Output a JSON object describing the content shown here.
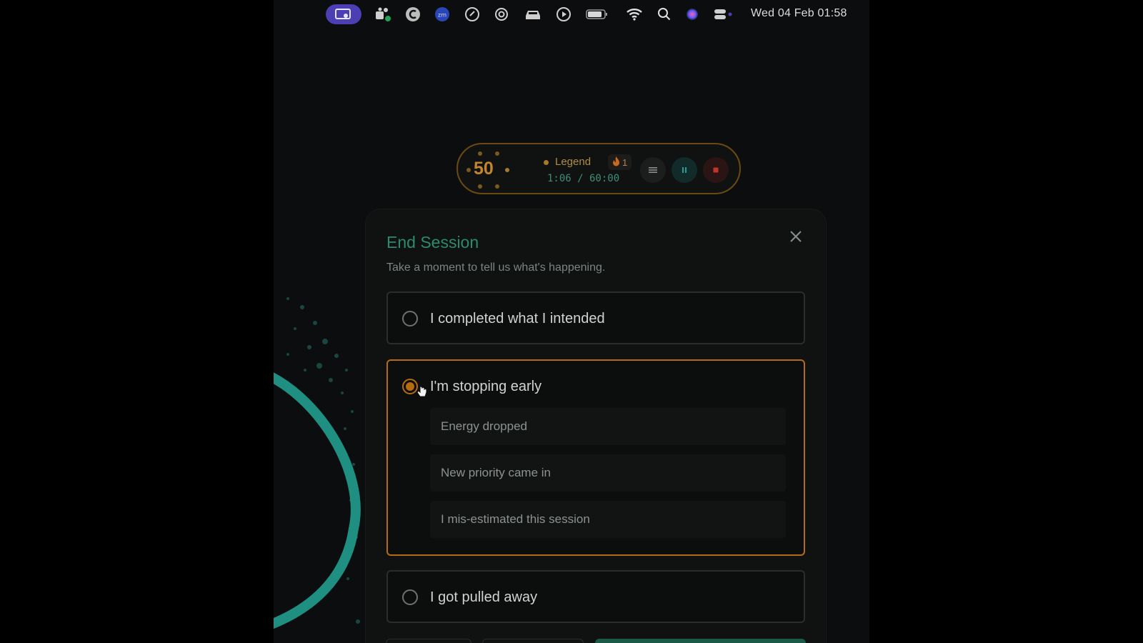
{
  "menubar": {
    "clock": "Wed 04 Feb  01:58",
    "icons": [
      "screen-share-icon",
      "teams-icon",
      "c-app-icon",
      "zoom-icon",
      "link-icon",
      "openai-icon",
      "car-icon",
      "play-icon",
      "battery-icon",
      "wifi-icon",
      "search-icon",
      "siri-icon",
      "control-center-icon"
    ],
    "zoom_label": "zm"
  },
  "timer": {
    "score": "50",
    "tier": "Legend",
    "streak": "1",
    "elapsed": "1:06 / 60:00",
    "menu_icon": "menu-icon",
    "pause_icon": "pause-icon",
    "stop_icon": "stop-icon"
  },
  "modal": {
    "title": "End Session",
    "subtitle": "Take a moment to tell us what's happening.",
    "options": [
      {
        "label": "I completed what I intended",
        "selected": false
      },
      {
        "label": "I'm stopping early",
        "selected": true,
        "reasons": [
          "Energy dropped",
          "New priority came in",
          "I mis-estimated this session"
        ]
      },
      {
        "label": "I got pulled away",
        "selected": false
      }
    ]
  },
  "colors": {
    "accent_orange": "#b66a12",
    "accent_teal": "#2e8a6e",
    "menubar_active": "#4b3fb3"
  }
}
